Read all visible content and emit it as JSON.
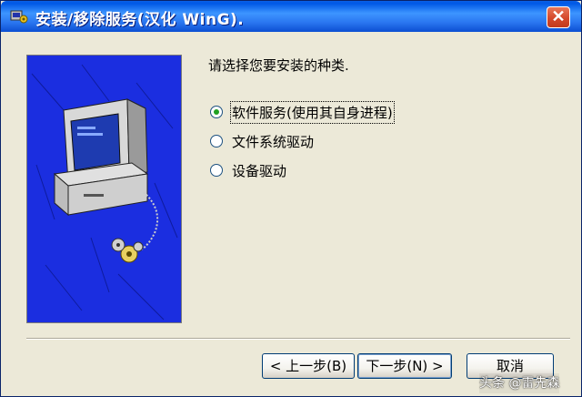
{
  "window": {
    "title": "安装/移除服务(汉化 WinG).",
    "close_glyph": "✕"
  },
  "illustration": {
    "name": "computer-with-gears-illustration",
    "background_color": "#1B2EE0"
  },
  "content": {
    "prompt": "请选择您要安装的种类.",
    "options": [
      {
        "label": "软件服务(使用其自身进程)",
        "selected": true
      },
      {
        "label": "文件系统驱动",
        "selected": false
      },
      {
        "label": "设备驱动",
        "selected": false
      }
    ]
  },
  "buttons": {
    "back": "< 上一步(B)",
    "next": "下一步(N) >",
    "cancel": "取消"
  },
  "watermark": "头条 @雷先森",
  "colors": {
    "titlebar": "#0058E6",
    "close": "#D5492B",
    "dialog_bg": "#ECE9D8",
    "radio_dot": "#21A121"
  }
}
